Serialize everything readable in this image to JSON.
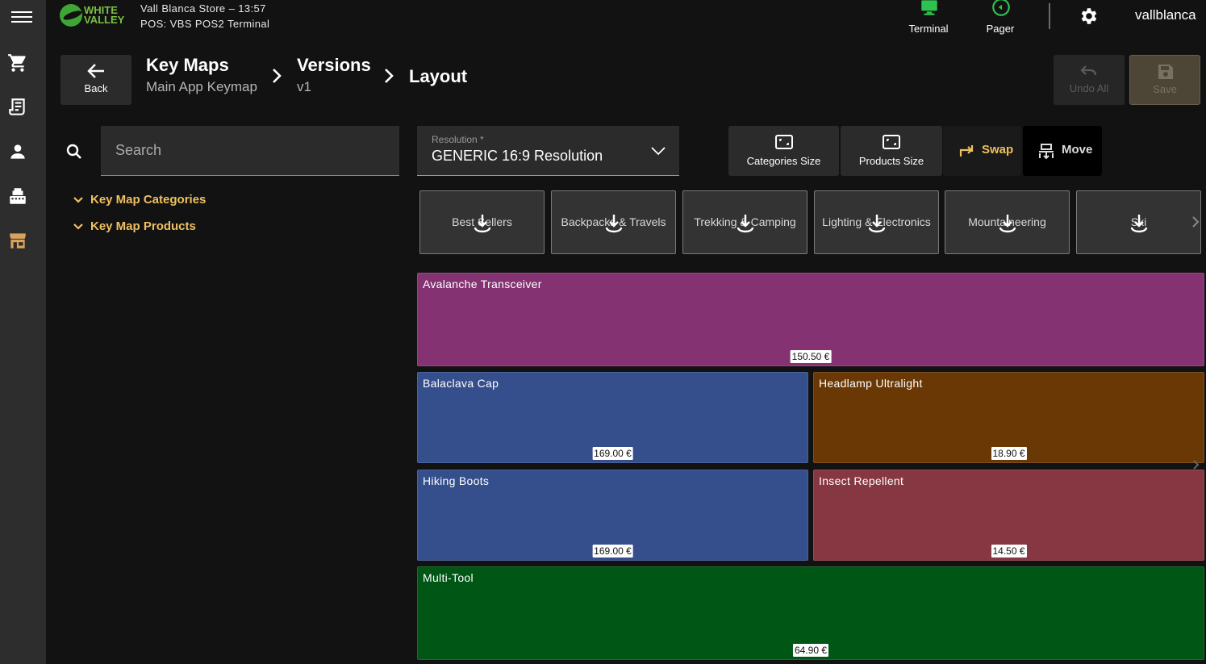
{
  "app": {
    "logo_line1": "WHITE",
    "logo_line2": "VALLEY",
    "store_line": "Vall Blanca Store – 13:57",
    "pos_line": "POS: VBS POS2 Terminal",
    "terminal_label": "Terminal",
    "pager_label": "Pager",
    "username": "vallblanca"
  },
  "header": {
    "back_label": "Back",
    "crumb1_title": "Key Maps",
    "crumb1_sub": "Main App Keymap",
    "crumb2_title": "Versions",
    "crumb2_sub": "v1",
    "crumb3_title": "Layout",
    "undo_label": "Undo All",
    "save_label": "Save"
  },
  "sidebar": {
    "search_placeholder": "Search",
    "tree": [
      "Key Map Categories",
      "Key Map Products"
    ]
  },
  "toolbar": {
    "resolution_label": "Resolution *",
    "resolution_value": "GENERIC 16:9 Resolution",
    "categories_size": "Categories Size",
    "products_size": "Products Size",
    "swap": "Swap",
    "move": "Move"
  },
  "categories": [
    "Best Sellers",
    "Backpacks & Travels",
    "Trekking & Camping",
    "Lighting & Electronics",
    "Mountaineering",
    "Ski"
  ],
  "products": [
    {
      "name": "Avalanche Transceiver",
      "price": "150.50 €",
      "color": "#843272"
    },
    {
      "name": "Balaclava Cap",
      "price": "169.00 €",
      "color": "#354e8c"
    },
    {
      "name": "Headlamp Ultralight",
      "price": "18.90 €",
      "color": "#693804"
    },
    {
      "name": "Hiking Boots",
      "price": "169.00 €",
      "color": "#354e8c"
    },
    {
      "name": "Insect Repellent",
      "price": "14.50 €",
      "color": "#863741"
    },
    {
      "name": "Multi-Tool",
      "price": "64.90 €",
      "color": "#005615"
    }
  ],
  "colors": {
    "accent": "#f0c060",
    "terminal_icon": "#2ec24f",
    "rail": "#2d2d2d"
  }
}
